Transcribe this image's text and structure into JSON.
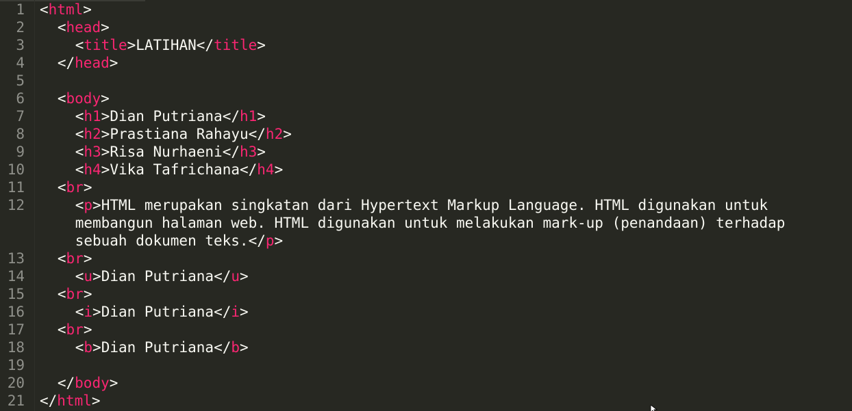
{
  "editor": {
    "theme": {
      "background": "#272822",
      "text": "#f8f8f2",
      "tag": "#f92672",
      "line_number": "#8f908a"
    },
    "lines": [
      {
        "num": "1",
        "indent": 0,
        "tokens": [
          {
            "t": "<",
            "c": "pun"
          },
          {
            "t": "html",
            "c": "tag"
          },
          {
            "t": ">",
            "c": "pun"
          }
        ]
      },
      {
        "num": "2",
        "indent": 1,
        "tokens": [
          {
            "t": "<",
            "c": "pun"
          },
          {
            "t": "head",
            "c": "tag"
          },
          {
            "t": ">",
            "c": "pun"
          }
        ]
      },
      {
        "num": "3",
        "indent": 2,
        "tokens": [
          {
            "t": "<",
            "c": "pun"
          },
          {
            "t": "title",
            "c": "tag"
          },
          {
            "t": ">",
            "c": "pun"
          },
          {
            "t": "LATIHAN",
            "c": "txt"
          },
          {
            "t": "</",
            "c": "pun"
          },
          {
            "t": "title",
            "c": "tag"
          },
          {
            "t": ">",
            "c": "pun"
          }
        ]
      },
      {
        "num": "4",
        "indent": 1,
        "tokens": [
          {
            "t": "</",
            "c": "pun"
          },
          {
            "t": "head",
            "c": "tag"
          },
          {
            "t": ">",
            "c": "pun"
          }
        ]
      },
      {
        "num": "5",
        "indent": 0,
        "tokens": []
      },
      {
        "num": "6",
        "indent": 1,
        "tokens": [
          {
            "t": "<",
            "c": "pun"
          },
          {
            "t": "body",
            "c": "tag"
          },
          {
            "t": ">",
            "c": "pun"
          }
        ]
      },
      {
        "num": "7",
        "indent": 2,
        "tokens": [
          {
            "t": "<",
            "c": "pun"
          },
          {
            "t": "h1",
            "c": "tag"
          },
          {
            "t": ">",
            "c": "pun"
          },
          {
            "t": "Dian Putriana",
            "c": "txt"
          },
          {
            "t": "</",
            "c": "pun"
          },
          {
            "t": "h1",
            "c": "tag"
          },
          {
            "t": ">",
            "c": "pun"
          }
        ]
      },
      {
        "num": "8",
        "indent": 2,
        "tokens": [
          {
            "t": "<",
            "c": "pun"
          },
          {
            "t": "h2",
            "c": "tag"
          },
          {
            "t": ">",
            "c": "pun"
          },
          {
            "t": "Prastiana Rahayu",
            "c": "txt"
          },
          {
            "t": "</",
            "c": "pun"
          },
          {
            "t": "h2",
            "c": "tag"
          },
          {
            "t": ">",
            "c": "pun"
          }
        ]
      },
      {
        "num": "9",
        "indent": 2,
        "tokens": [
          {
            "t": "<",
            "c": "pun"
          },
          {
            "t": "h3",
            "c": "tag"
          },
          {
            "t": ">",
            "c": "pun"
          },
          {
            "t": "Risa Nurhaeni",
            "c": "txt"
          },
          {
            "t": "</",
            "c": "pun"
          },
          {
            "t": "h3",
            "c": "tag"
          },
          {
            "t": ">",
            "c": "pun"
          }
        ]
      },
      {
        "num": "10",
        "indent": 2,
        "tokens": [
          {
            "t": "<",
            "c": "pun"
          },
          {
            "t": "h4",
            "c": "tag"
          },
          {
            "t": ">",
            "c": "pun"
          },
          {
            "t": "Vika Tafrichana",
            "c": "txt"
          },
          {
            "t": "</",
            "c": "pun"
          },
          {
            "t": "h4",
            "c": "tag"
          },
          {
            "t": ">",
            "c": "pun"
          }
        ]
      },
      {
        "num": "11",
        "indent": 1,
        "tokens": [
          {
            "t": "<",
            "c": "pun"
          },
          {
            "t": "br",
            "c": "tag"
          },
          {
            "t": ">",
            "c": "pun"
          }
        ]
      },
      {
        "num": "12",
        "indent": 2,
        "tokens": [
          {
            "t": "<",
            "c": "pun"
          },
          {
            "t": "p",
            "c": "tag"
          },
          {
            "t": ">",
            "c": "pun"
          },
          {
            "t": "HTML merupakan singkatan dari Hypertext Markup Language. HTML digunakan untuk",
            "c": "txt"
          }
        ]
      },
      {
        "num": "",
        "indent": 2,
        "tokens": [
          {
            "t": "membangun halaman web. HTML digunakan untuk melakukan mark-up (penandaan) terhadap",
            "c": "txt"
          }
        ]
      },
      {
        "num": "",
        "indent": 2,
        "tokens": [
          {
            "t": "sebuah dokumen teks.",
            "c": "txt"
          },
          {
            "t": "</",
            "c": "pun"
          },
          {
            "t": "p",
            "c": "tag"
          },
          {
            "t": ">",
            "c": "pun"
          }
        ]
      },
      {
        "num": "13",
        "indent": 1,
        "tokens": [
          {
            "t": "<",
            "c": "pun"
          },
          {
            "t": "br",
            "c": "tag"
          },
          {
            "t": ">",
            "c": "pun"
          }
        ]
      },
      {
        "num": "14",
        "indent": 2,
        "tokens": [
          {
            "t": "<",
            "c": "pun"
          },
          {
            "t": "u",
            "c": "tag"
          },
          {
            "t": ">",
            "c": "pun"
          },
          {
            "t": "Dian Putriana",
            "c": "txt"
          },
          {
            "t": "</",
            "c": "pun"
          },
          {
            "t": "u",
            "c": "tag"
          },
          {
            "t": ">",
            "c": "pun"
          }
        ]
      },
      {
        "num": "15",
        "indent": 1,
        "tokens": [
          {
            "t": "<",
            "c": "pun"
          },
          {
            "t": "br",
            "c": "tag"
          },
          {
            "t": ">",
            "c": "pun"
          }
        ]
      },
      {
        "num": "16",
        "indent": 2,
        "tokens": [
          {
            "t": "<",
            "c": "pun"
          },
          {
            "t": "i",
            "c": "tag"
          },
          {
            "t": ">",
            "c": "pun"
          },
          {
            "t": "Dian Putriana",
            "c": "txt"
          },
          {
            "t": "</",
            "c": "pun"
          },
          {
            "t": "i",
            "c": "tag"
          },
          {
            "t": ">",
            "c": "pun"
          }
        ]
      },
      {
        "num": "17",
        "indent": 1,
        "tokens": [
          {
            "t": "<",
            "c": "pun"
          },
          {
            "t": "br",
            "c": "tag"
          },
          {
            "t": ">",
            "c": "pun"
          }
        ]
      },
      {
        "num": "18",
        "indent": 2,
        "tokens": [
          {
            "t": "<",
            "c": "pun"
          },
          {
            "t": "b",
            "c": "tag"
          },
          {
            "t": ">",
            "c": "pun"
          },
          {
            "t": "Dian Putriana",
            "c": "txt"
          },
          {
            "t": "</",
            "c": "pun"
          },
          {
            "t": "b",
            "c": "tag"
          },
          {
            "t": ">",
            "c": "pun"
          }
        ]
      },
      {
        "num": "19",
        "indent": 0,
        "tokens": []
      },
      {
        "num": "20",
        "indent": 1,
        "tokens": [
          {
            "t": "</",
            "c": "pun"
          },
          {
            "t": "body",
            "c": "tag"
          },
          {
            "t": ">",
            "c": "pun"
          }
        ]
      },
      {
        "num": "21",
        "indent": 0,
        "tokens": [
          {
            "t": "</",
            "c": "pun"
          },
          {
            "t": "html",
            "c": "tag"
          },
          {
            "t": ">",
            "c": "pun"
          }
        ]
      }
    ]
  }
}
